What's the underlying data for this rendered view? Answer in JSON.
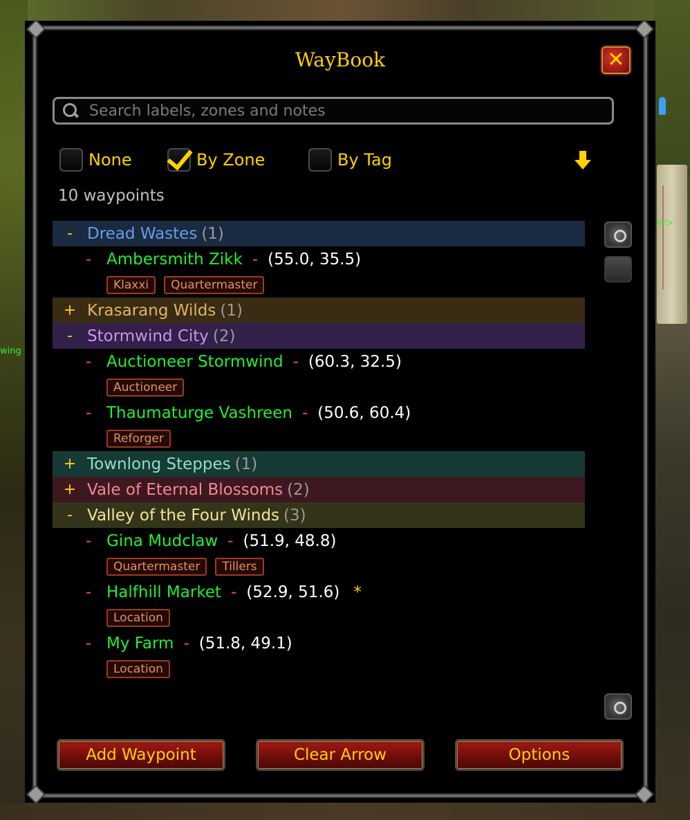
{
  "window": {
    "title": "WayBook",
    "close_icon": "close-x-icon"
  },
  "search": {
    "placeholder": "Search labels, zones and notes",
    "value": ""
  },
  "grouping": {
    "options": [
      {
        "label": "None",
        "checked": false
      },
      {
        "label": "By Zone",
        "checked": true
      },
      {
        "label": "By Tag",
        "checked": false
      }
    ],
    "sort_icon": "down-arrow-icon"
  },
  "count_text": "10 waypoints",
  "zones": [
    {
      "name": "Dread Wastes",
      "count": "(1)",
      "toggle": "-",
      "color": "#1a2a40",
      "text_color": "#6a9ce6",
      "waypoints": [
        {
          "dash": "-",
          "name": "Ambersmith Zikk",
          "sep": "-",
          "coords": "(55.0, 35.5)",
          "star": "",
          "tags": [
            "Klaxxi",
            "Quartermaster"
          ]
        }
      ]
    },
    {
      "name": "Krasarang Wilds",
      "count": "(1)",
      "toggle": "+",
      "color": "#3a2c14",
      "text_color": "#e0b464",
      "waypoints": []
    },
    {
      "name": "Stormwind City",
      "count": "(2)",
      "toggle": "-",
      "color": "#32204a",
      "text_color": "#c894ec",
      "waypoints": [
        {
          "dash": "-",
          "name": "Auctioneer Stormwind",
          "sep": "-",
          "coords": "(60.3, 32.5)",
          "star": "",
          "tags": [
            "Auctioneer"
          ]
        },
        {
          "dash": "-",
          "name": "Thaumaturge Vashreen",
          "sep": "-",
          "coords": "(50.6, 60.4)",
          "star": "",
          "tags": [
            "Reforger"
          ]
        }
      ]
    },
    {
      "name": "Townlong Steppes",
      "count": "(1)",
      "toggle": "+",
      "color": "#163a36",
      "text_color": "#8ee0c4",
      "waypoints": []
    },
    {
      "name": "Vale of Eternal Blossoms",
      "count": "(2)",
      "toggle": "+",
      "color": "#3e1820",
      "text_color": "#ef8a90",
      "waypoints": []
    },
    {
      "name": "Valley of the Four Winds",
      "count": "(3)",
      "toggle": "-",
      "color": "#34341a",
      "text_color": "#eee69a",
      "waypoints": [
        {
          "dash": "-",
          "name": "Gina Mudclaw",
          "sep": "-",
          "coords": "(51.9, 48.8)",
          "star": "",
          "tags": [
            "Quartermaster",
            "Tillers"
          ]
        },
        {
          "dash": "-",
          "name": "Halfhill Market",
          "sep": "-",
          "coords": "(52.9, 51.6)",
          "star": "*",
          "tags": [
            "Location"
          ]
        },
        {
          "dash": "-",
          "name": "My Farm",
          "sep": "-",
          "coords": "(51.8, 49.1)",
          "star": "",
          "tags": [
            "Location"
          ]
        }
      ]
    }
  ],
  "buttons": {
    "add": "Add Waypoint",
    "clear": "Clear Arrow",
    "options": "Options"
  },
  "world": {
    "left_text": "wing",
    "right_text": "er>"
  }
}
